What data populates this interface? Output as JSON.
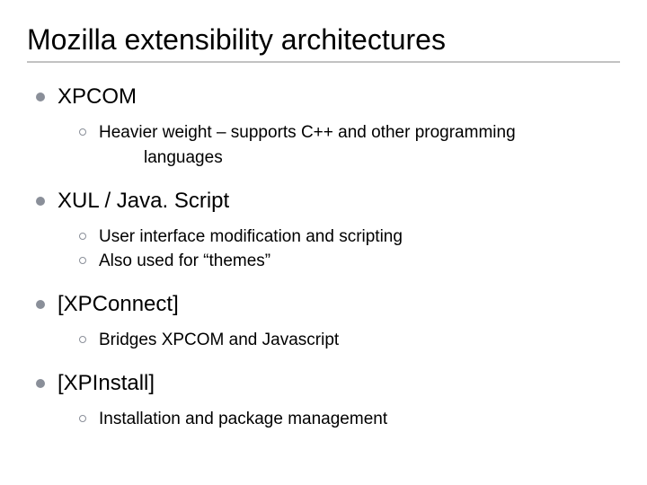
{
  "title": "Mozilla extensibility architectures",
  "items": [
    {
      "label": "XPCOM",
      "sub": [
        {
          "lead": "Heavier weight – supports C++ and other programming",
          "cont": "languages"
        }
      ]
    },
    {
      "label": "XUL / Java. Script",
      "sub": [
        {
          "lead": "User interface modification and scripting"
        },
        {
          "lead": "Also used for “themes”"
        }
      ]
    },
    {
      "label": "[XPConnect]",
      "sub": [
        {
          "lead": "Bridges XPCOM and Javascript"
        }
      ]
    },
    {
      "label": "[XPInstall]",
      "sub": [
        {
          "lead": "Installation and package management"
        }
      ]
    }
  ]
}
